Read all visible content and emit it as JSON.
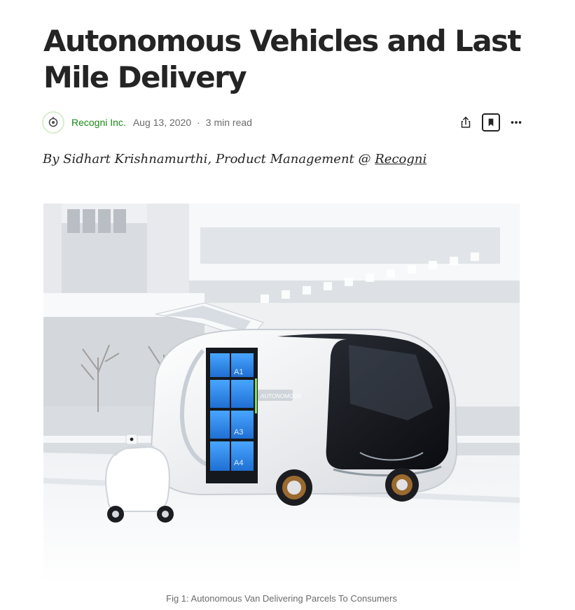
{
  "article": {
    "title": "Autonomous Vehicles and Last Mile Delivery",
    "byline_prefix": "By Sidhart Krishnamurthi, Product Management @ ",
    "byline_link": "Recogni",
    "figure_caption": "Fig 1: Autonomous Van Delivering Parcels To Consumers"
  },
  "meta": {
    "publication": "Recogni Inc.",
    "date": "Aug 13, 2020",
    "separator": "·",
    "read_time": "3 min read"
  },
  "image": {
    "van_badge": "AUTONOMOUS",
    "lockers": [
      "A1",
      "A3",
      "A4"
    ]
  },
  "colors": {
    "accent_green": "#1a8917",
    "text": "#242424",
    "muted": "#6b6b6b",
    "locker_blue": "#2e8ee8"
  },
  "icons": {
    "share": "share-icon",
    "bookmark": "bookmark-icon",
    "more": "more-icon"
  }
}
